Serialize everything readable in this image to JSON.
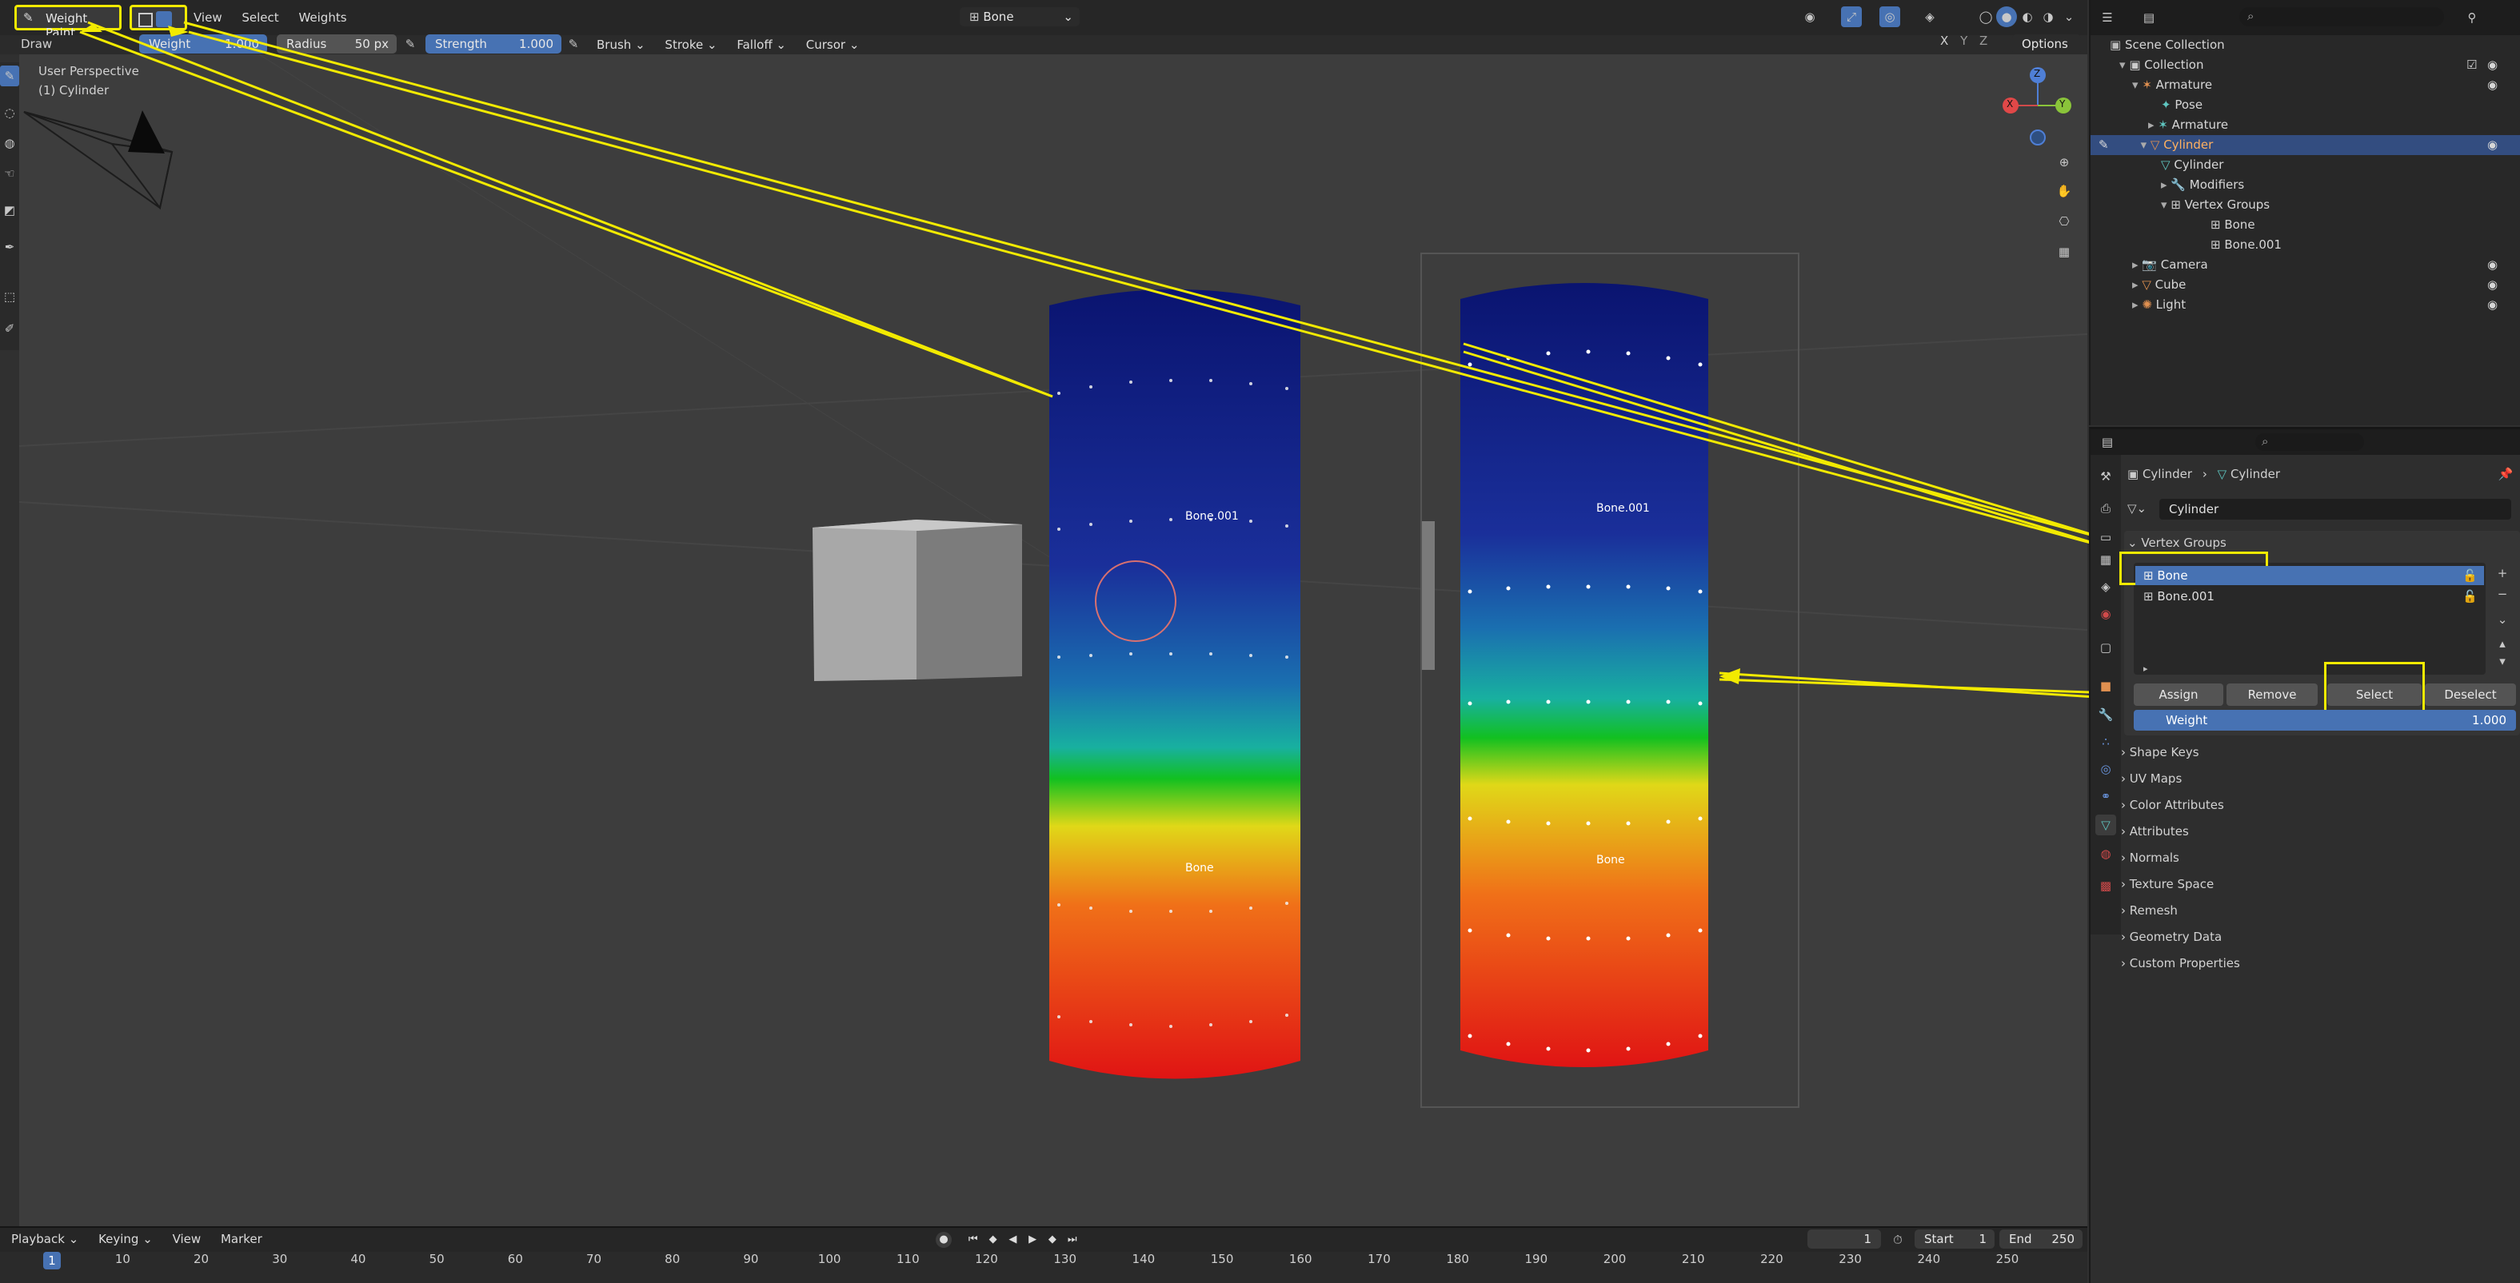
{
  "header": {
    "mode": "Weight Paint",
    "menus": [
      "View",
      "Select",
      "Weights"
    ],
    "active_group_label": "Bone",
    "tool_label": "Draw",
    "weight": {
      "label": "Weight",
      "value": "1.000"
    },
    "radius": {
      "label": "Radius",
      "value": "50 px"
    },
    "strength": {
      "label": "Strength",
      "value": "1.000"
    },
    "dropdowns": [
      "Brush",
      "Stroke",
      "Falloff",
      "Cursor"
    ],
    "options": "Options",
    "xyz": [
      "X",
      "Y",
      "Z"
    ]
  },
  "viewport": {
    "perspective": "User Perspective",
    "object_label": "(1) Cylinder",
    "left_cylinder_labels": {
      "top": "Bone.001",
      "bottom": "Bone"
    },
    "right_cylinder_labels": {
      "top": "Bone.001",
      "bottom": "Bone"
    },
    "gizmo_axes": {
      "z": "Z",
      "y": "Y",
      "x": "X"
    }
  },
  "outliner": {
    "items": [
      {
        "label": "Scene Collection",
        "depth": 0
      },
      {
        "label": "Collection",
        "depth": 1
      },
      {
        "label": "Armature",
        "depth": 2
      },
      {
        "label": "Pose",
        "depth": 3
      },
      {
        "label": "Armature",
        "depth": 3
      },
      {
        "label": "Cylinder",
        "depth": 2,
        "selected": true
      },
      {
        "label": "Cylinder",
        "depth": 3
      },
      {
        "label": "Modifiers",
        "depth": 3
      },
      {
        "label": "Vertex Groups",
        "depth": 3
      },
      {
        "label": "Bone",
        "depth": 4
      },
      {
        "label": "Bone.001",
        "depth": 4
      },
      {
        "label": "Camera",
        "depth": 2
      },
      {
        "label": "Cube",
        "depth": 2
      },
      {
        "label": "Light",
        "depth": 2
      }
    ]
  },
  "properties": {
    "breadcrumb": [
      "Cylinder",
      "Cylinder"
    ],
    "mesh_name": "Cylinder",
    "vertex_groups": {
      "title": "Vertex Groups",
      "groups": [
        "Bone",
        "Bone.001"
      ],
      "buttons": [
        "Assign",
        "Remove",
        "Select",
        "Deselect"
      ],
      "weight_label": "Weight",
      "weight_value": "1.000"
    },
    "panels": [
      "Shape Keys",
      "UV Maps",
      "Color Attributes",
      "Attributes",
      "Normals",
      "Texture Space",
      "Remesh",
      "Geometry Data",
      "Custom Properties"
    ]
  },
  "timeline": {
    "menus": [
      "Playback",
      "Keying",
      "View",
      "Marker"
    ],
    "current_frame": "1",
    "start_label": "Start",
    "start": "1",
    "end_label": "End",
    "end": "250",
    "ticks": [
      "1",
      "10",
      "20",
      "30",
      "40",
      "50",
      "60",
      "70",
      "80",
      "90",
      "100",
      "110",
      "120",
      "130",
      "140",
      "150",
      "160",
      "170",
      "180",
      "190",
      "200",
      "210",
      "220",
      "230",
      "240",
      "250"
    ]
  },
  "colors": {
    "selection_blue": "#4772b3",
    "annotation_yellow": "#f2ea00",
    "background": "#303030"
  }
}
